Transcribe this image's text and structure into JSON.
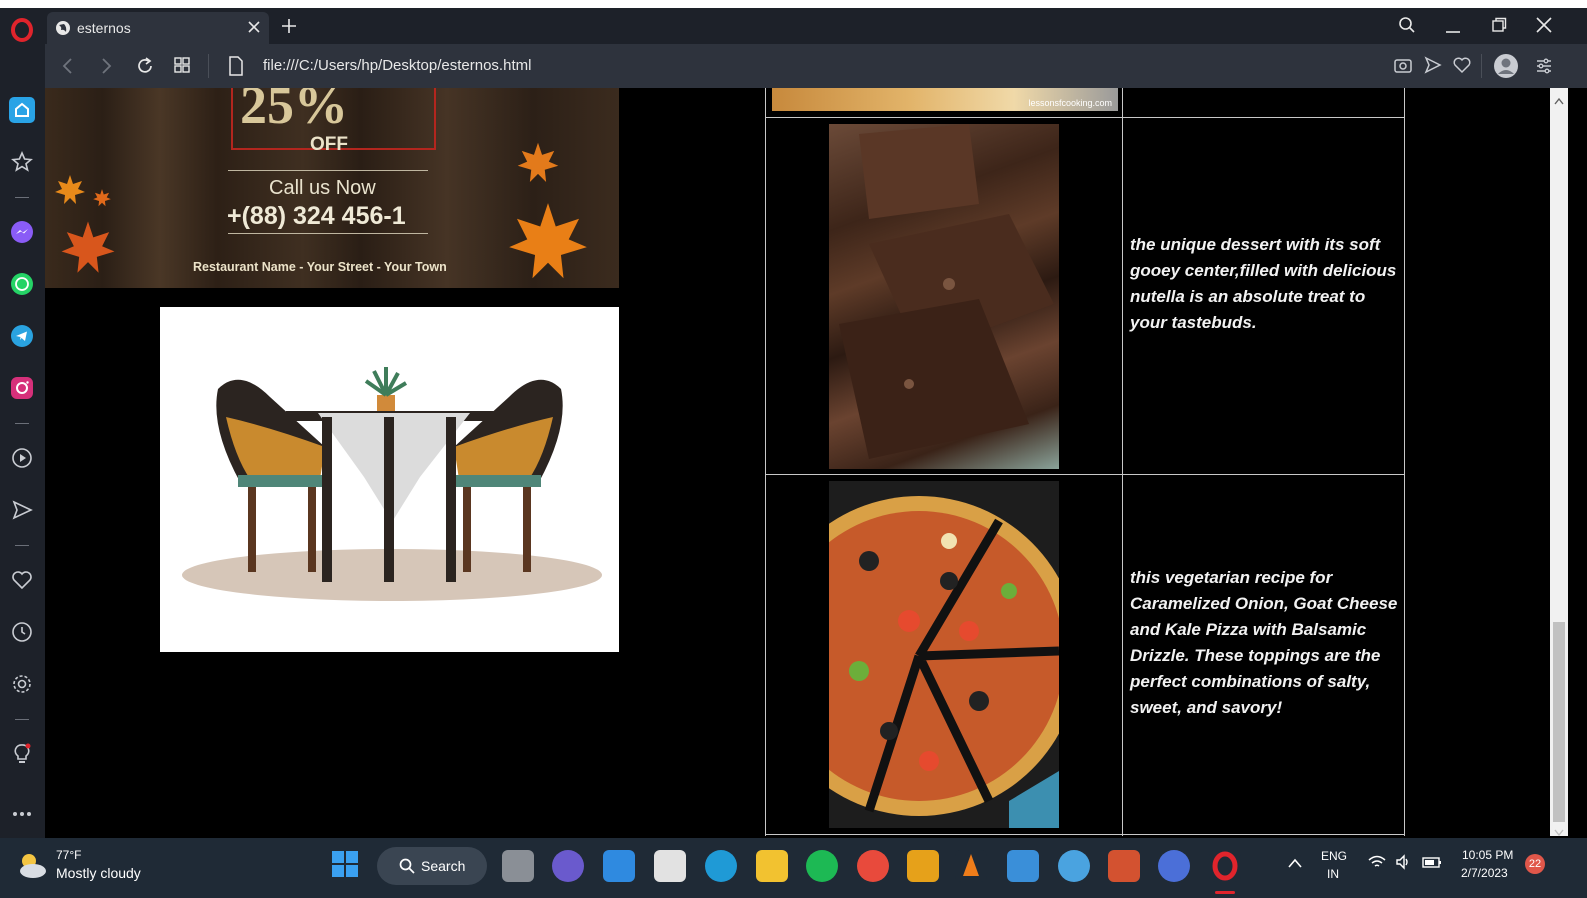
{
  "browser": {
    "tab_title": "esternos",
    "url": "file:///C:/Users/hp/Desktop/esternos.html"
  },
  "poster": {
    "discount": "25%",
    "off": "OFF",
    "call": "Call us Now",
    "phone": "+(88) 324 456-1",
    "address": "Restaurant Name - Your Street - Your Town"
  },
  "menu": {
    "items": [
      {
        "image_icon": "brownie-image",
        "description": "the unique dessert with its soft gooey center,filled with delicious nutella is an absolute treat to your tastebuds."
      },
      {
        "image_icon": "pizza-image",
        "description": "this vegetarian recipe for Caramelized Onion, Goat Cheese and Kale Pizza with Balsamic Drizzle. These toppings are the perfect combinations of salty, sweet, and savory!"
      }
    ],
    "watermark": "lessonsfcooking.com"
  },
  "taskbar": {
    "weather_temp": "77°F",
    "weather_desc": "Mostly cloudy",
    "search_label": "Search",
    "lang_line1": "ENG",
    "lang_line2": "IN",
    "time": "10:05 PM",
    "date": "2/7/2023",
    "notification_count": "22"
  },
  "colors": {
    "sidebar_bg": "#1d2129",
    "addressbar_bg": "#2e333d",
    "opera_red": "#e0242c",
    "taskbar_bg": "#1f2a36"
  }
}
